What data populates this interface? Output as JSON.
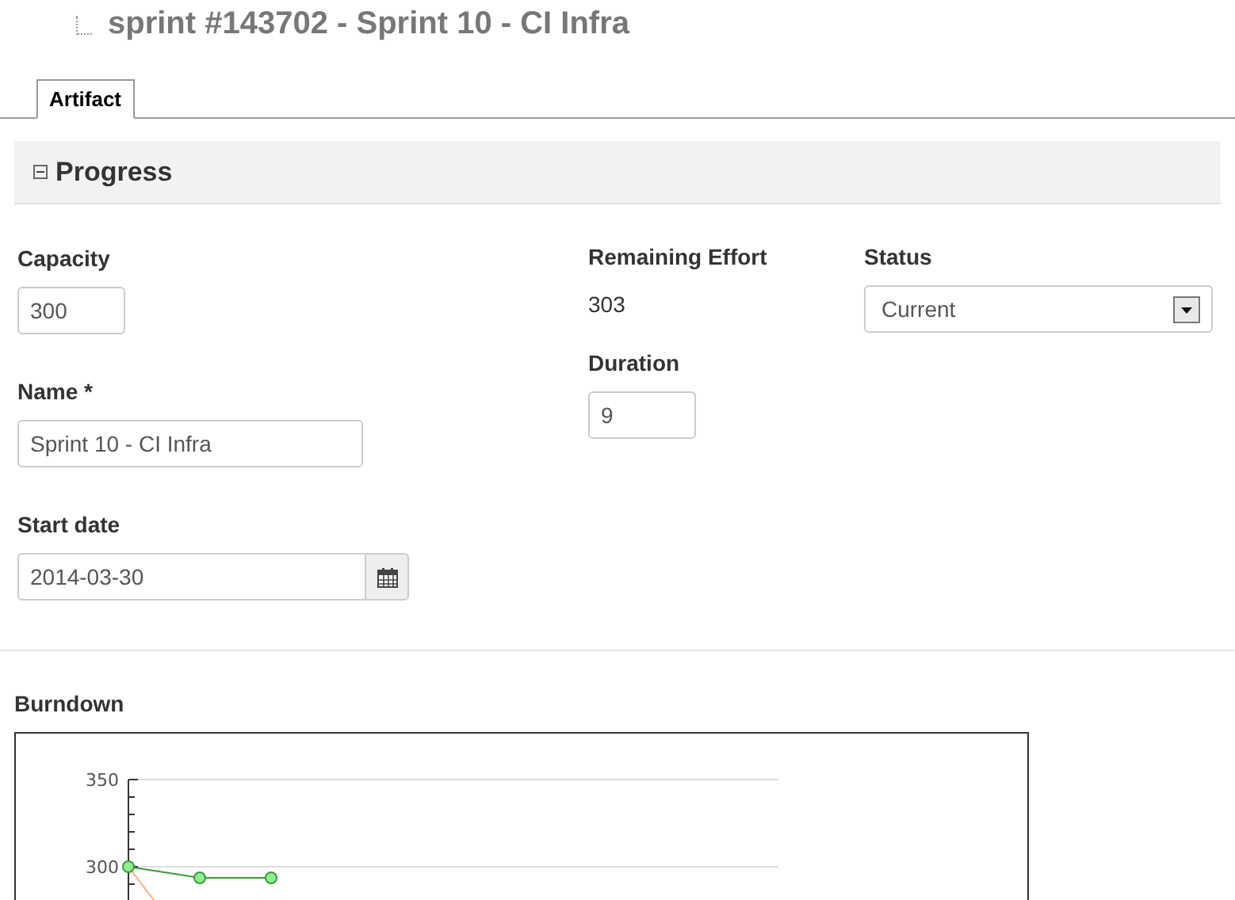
{
  "header": {
    "title": "sprint #143702 - Sprint 10 - CI Infra"
  },
  "tabs": [
    {
      "label": "Artifact",
      "selected": true
    }
  ],
  "section": {
    "title": "Progress",
    "expanded": true
  },
  "fields": {
    "capacity": {
      "label": "Capacity",
      "value": "300"
    },
    "name": {
      "label": "Name *",
      "value": "Sprint 10 - CI Infra"
    },
    "start_date": {
      "label": "Start date",
      "value": "2014-03-30"
    },
    "remaining_effort": {
      "label": "Remaining Effort",
      "value": "303"
    },
    "duration": {
      "label": "Duration",
      "value": "9"
    },
    "status": {
      "label": "Status",
      "value": "Current"
    }
  },
  "burndown": {
    "title": "Burndown",
    "y_tick_labels": [
      "350",
      "300"
    ]
  }
}
